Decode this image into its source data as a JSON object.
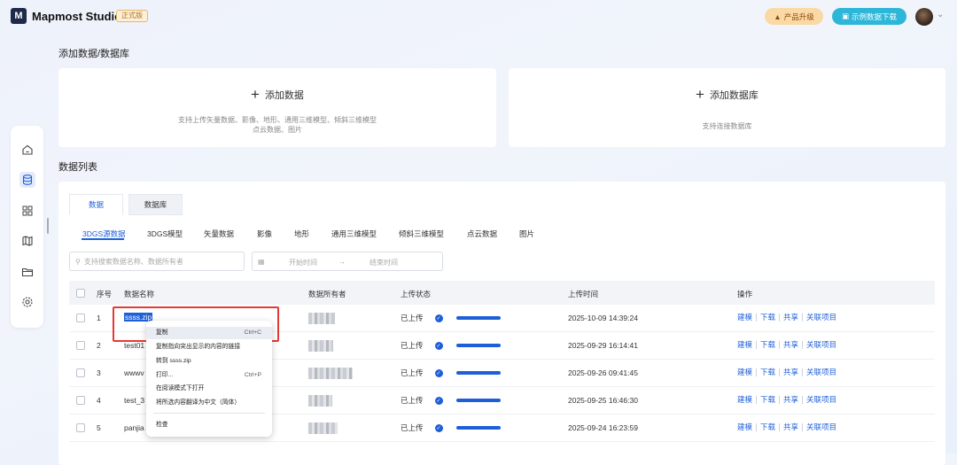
{
  "topbar": {
    "brand": "Mapmost Studio",
    "edition": "正式版",
    "upgrade_label": "产品升级",
    "sample_label": "示例数据下载"
  },
  "add_section": {
    "title": "添加数据/数据库",
    "add_data": {
      "label": "添加数据",
      "desc_line1": "支持上传矢量数据、影像、地形、通用三维模型、倾斜三维模型",
      "desc_line2": "点云数据、图片"
    },
    "add_db": {
      "label": "添加数据库",
      "desc": "支持连接数据库"
    }
  },
  "list": {
    "title": "数据列表",
    "tabs": [
      "数据",
      "数据库"
    ],
    "subtabs": [
      "3DGS源数据",
      "3DGS模型",
      "矢量数据",
      "影像",
      "地形",
      "通用三维模型",
      "倾斜三维模型",
      "点云数据",
      "图片"
    ],
    "search_placeholder": "支持搜索数据名称、数据所有者",
    "date_start": "开始时间",
    "date_arrow": "→",
    "date_end": "结束时间",
    "headers": {
      "index": "序号",
      "name": "数据名称",
      "owner": "数据所有者",
      "status": "上传状态",
      "time": "上传时间",
      "ops": "操作"
    },
    "rows": [
      {
        "index": "1",
        "name": "ssss.zip",
        "status": "已上传",
        "progress": 1.0,
        "time": "2025-10-09 14:39:24"
      },
      {
        "index": "2",
        "name": "test01",
        "status": "已上传",
        "progress": 1.0,
        "time": "2025-09-29 16:14:41"
      },
      {
        "index": "3",
        "name": "wwwv",
        "status": "已上传",
        "progress": 1.0,
        "time": "2025-09-26 09:41:45"
      },
      {
        "index": "4",
        "name": "test_3",
        "status": "已上传",
        "progress": 1.0,
        "time": "2025-09-25 16:46:30"
      },
      {
        "index": "5",
        "name": "panjia",
        "status": "已上传",
        "progress": 1.0,
        "time": "2025-09-24 16:23:59"
      }
    ],
    "ops": [
      "建模",
      "下载",
      "共享",
      "关联项目"
    ]
  },
  "context_menu": {
    "items": [
      {
        "label": "复制",
        "shortcut": "Ctrl+C"
      },
      {
        "label": "复制指向突出显示的内容的链接",
        "shortcut": ""
      },
      {
        "label": "转到 ssss.zip",
        "shortcut": ""
      },
      {
        "label": "打印...",
        "shortcut": "Ctrl+P"
      },
      {
        "label": "在阅读模式下打开",
        "shortcut": ""
      },
      {
        "label": "将所选内容翻译为中文（简体）",
        "shortcut": ""
      },
      {
        "label": "检查",
        "shortcut": ""
      }
    ]
  },
  "colors": {
    "accent": "#1e5fd8",
    "upgrade_bg": "#fbd9a4",
    "sample_bg": "#2cb6d8",
    "highlight_box": "#e53935"
  }
}
